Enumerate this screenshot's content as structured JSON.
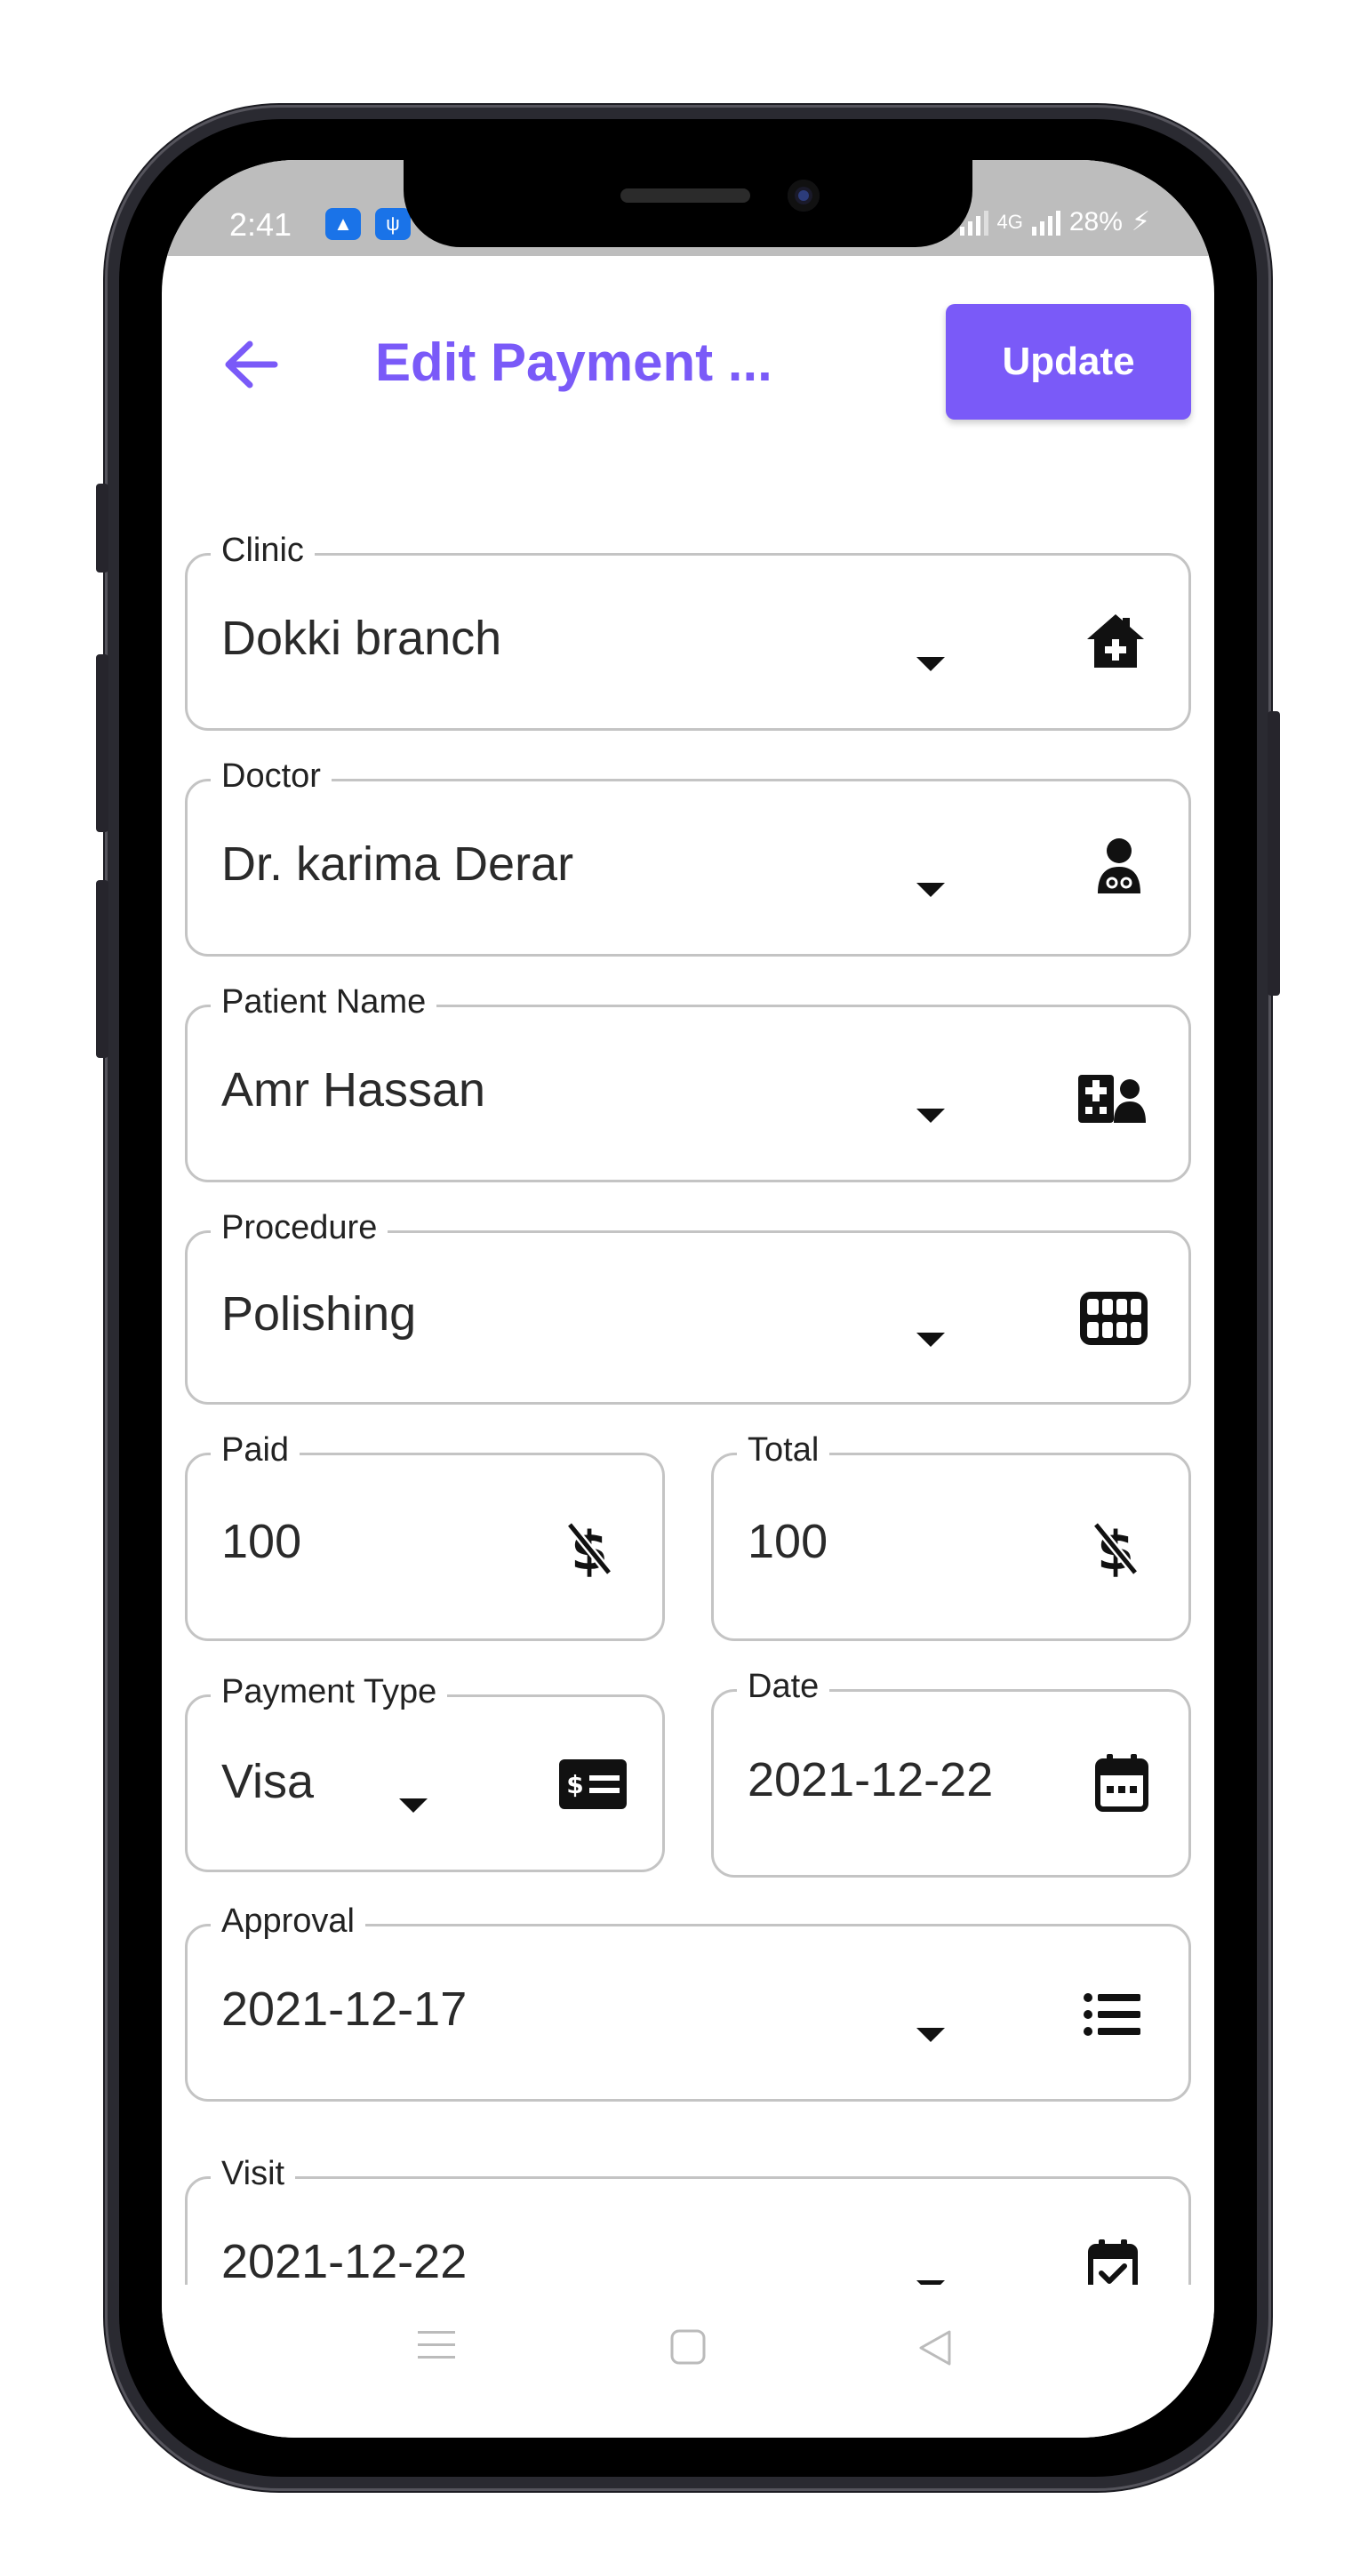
{
  "status_bar": {
    "time": "2:41",
    "network": "4G",
    "battery": "28%"
  },
  "header": {
    "title": "Edit Payment ...",
    "update_label": "Update",
    "back_icon": "arrow-left-icon"
  },
  "colors": {
    "accent": "#7a5af8",
    "border": "#c4c4c4",
    "status_bar": "#bdbdbd"
  },
  "form": {
    "clinic": {
      "label": "Clinic",
      "value": "Dokki branch",
      "icon": "clinic-house-icon"
    },
    "doctor": {
      "label": "Doctor",
      "value": "Dr. karima Derar",
      "icon": "doctor-icon"
    },
    "patient": {
      "label": "Patient Name",
      "value": "Amr Hassan",
      "icon": "hospital-user-icon"
    },
    "procedure": {
      "label": "Procedure",
      "value": "Polishing",
      "icon": "teeth-icon"
    },
    "paid": {
      "label": "Paid",
      "value": "100",
      "icon": "money-off-icon"
    },
    "total": {
      "label": "Total",
      "value": "100",
      "icon": "money-off-icon"
    },
    "payment_type": {
      "label": "Payment Type",
      "value": "Visa",
      "icon": "card-icon"
    },
    "date": {
      "label": "Date",
      "value": "2021-12-22",
      "icon": "calendar-icon"
    },
    "approval": {
      "label": "Approval",
      "value": "2021-12-17",
      "icon": "list-icon"
    },
    "visit": {
      "label": "Visit",
      "value": "2021-12-22",
      "icon": "calendar-check-icon"
    }
  }
}
